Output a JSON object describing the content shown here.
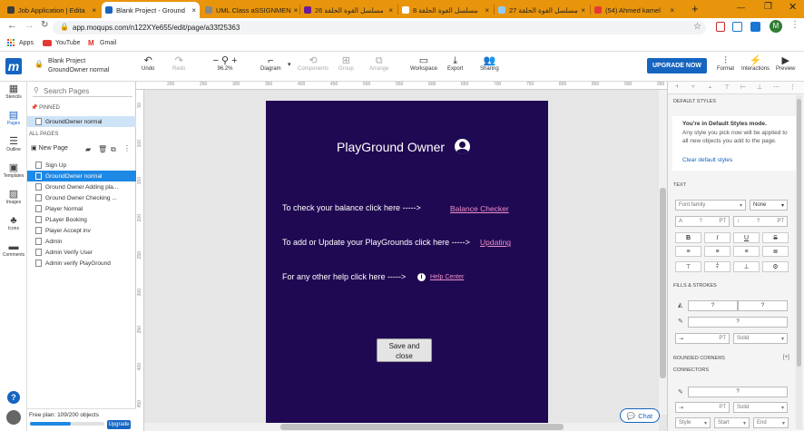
{
  "browser": {
    "tabs": [
      {
        "label": "Job Application | Edita",
        "favicon_color": "#3b3b3b"
      },
      {
        "label": "Blank Project - Ground",
        "favicon_color": "#1565c0"
      },
      {
        "label": "UML Class aSSIGNMEN",
        "favicon_color": "#888888"
      },
      {
        "label": "مسلسل القوة الحلقة 26",
        "favicon_color": "#6a1b9a"
      },
      {
        "label": "مسلسل القوة الحلقة 8",
        "favicon_color": "#ffffff"
      },
      {
        "label": "مسلسل القوة الحلقة 27",
        "favicon_color": "#90caf9"
      },
      {
        "label": "(54) Ahmed kamel",
        "favicon_color": "#e53935"
      }
    ],
    "close_glyph": "×",
    "new_tab": "+",
    "url": "app.moqups.com/n122XYe655/edit/page/a33f25363",
    "bookmarks": [
      "Apps",
      "YouTube",
      "Gmail"
    ],
    "profile_initial": "M"
  },
  "app": {
    "logo": "m",
    "project_title": "Blank Project",
    "page_name": "GroundOwner normal",
    "zoom": "96.2%",
    "toolbar": {
      "undo": "Undo",
      "redo": "Redo",
      "diagram": "Diagram",
      "components": "Components",
      "group": "Group",
      "arrange": "Arrange",
      "workspace": "Workspace",
      "export": "Export",
      "sharing": "Sharing",
      "upgrade": "UPGRADE NOW",
      "format": "Format",
      "interactions": "Interactions",
      "preview": "Preview"
    }
  },
  "rail": [
    "Stencils",
    "Pages",
    "Outline",
    "Templates",
    "Images",
    "Icons",
    "Comments"
  ],
  "pages_panel": {
    "search_placeholder": "Search Pages",
    "pinned_label": "PINNED",
    "pinned_page": "GroundOwner normal",
    "all_pages_label": "ALL PAGES",
    "new_page": "New Page",
    "pages": [
      "Sign Up",
      "GroundOwner normal",
      "Ground Owner Adding pla...",
      "Ground Owner Checking ...",
      "Player Normal",
      "PLayer Booking",
      "Player Accept inv",
      "Admin",
      "Admin Verify User",
      "Admin verify PlayGround"
    ],
    "plan_text": "Free plan: 109/200 objects",
    "plan_fraction": 0.545,
    "upgrade_button": "Upgrade"
  },
  "rulers": {
    "top": [
      "200",
      "250",
      "300",
      "350",
      "400",
      "450",
      "500",
      "550",
      "600",
      "650",
      "700",
      "750",
      "800",
      "850",
      "900",
      "950"
    ],
    "left": [
      "50",
      "100",
      "150",
      "200",
      "250",
      "300",
      "350",
      "400",
      "450"
    ]
  },
  "mockup": {
    "title": "PlayGround Owner",
    "line1": "To check your balance click here ----->",
    "link1": "Balance Checker",
    "line2": "To add or Update your PlayGrounds click here ----->",
    "link2": "Updating",
    "line3": "For any other help click here ----->",
    "link3": "Help Center",
    "save_line1": "Save and",
    "save_line2": "close",
    "colors": {
      "page_bg": "#200953",
      "link": "#ee90c8"
    }
  },
  "chat_label": "Chat",
  "right_panel": {
    "default_styles": "DEFAULT STYLES",
    "default_mode_title": "You're in Default Styles mode.",
    "default_mode_body": "Any style you pick now will be applied to all new objects you add to the page.",
    "clear_link": "Clear default styles",
    "text_section": "TEXT",
    "font_family_placeholder": "Font family",
    "font_weight": "None",
    "q": "?",
    "pt": "PT",
    "fills_section": "FILLS & STROKES",
    "solid": "Solid",
    "rounded": "ROUNDED CORNERS",
    "connectors": "CONNECTORS",
    "style": "Style",
    "start": "Start",
    "end": "End"
  }
}
